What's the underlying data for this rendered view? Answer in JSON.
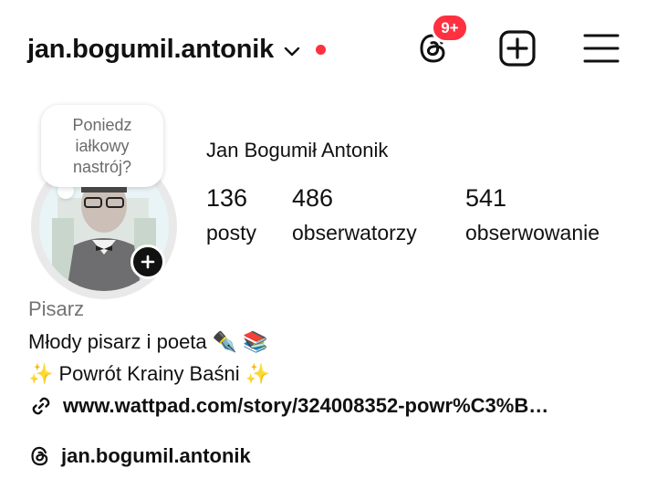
{
  "header": {
    "username": "jan.bogumil.antonik",
    "notification_badge": "9+",
    "icons": [
      "chevron-down-icon",
      "threads-icon",
      "create-plus-icon",
      "hamburger-menu-icon"
    ],
    "badge_color": "#ff3040"
  },
  "profile": {
    "note_text": "Poniedz iałkowy nastrój?",
    "full_name": "Jan Bogumił Antonik",
    "stats": {
      "posts": {
        "value": "136",
        "label": "posty"
      },
      "followers": {
        "value": "486",
        "label": "obserwatorzy"
      },
      "following": {
        "value": "541",
        "label": "obserwowanie"
      }
    }
  },
  "bio": {
    "category": "Pisarz",
    "line1": "Młody pisarz i poeta ✒️ 📚",
    "line2": "✨ Powrót Krainy Baśni ✨",
    "link": "www.wattpad.com/story/324008352-powr%C3%B…",
    "threads_handle": "jan.bogumil.antonik"
  }
}
